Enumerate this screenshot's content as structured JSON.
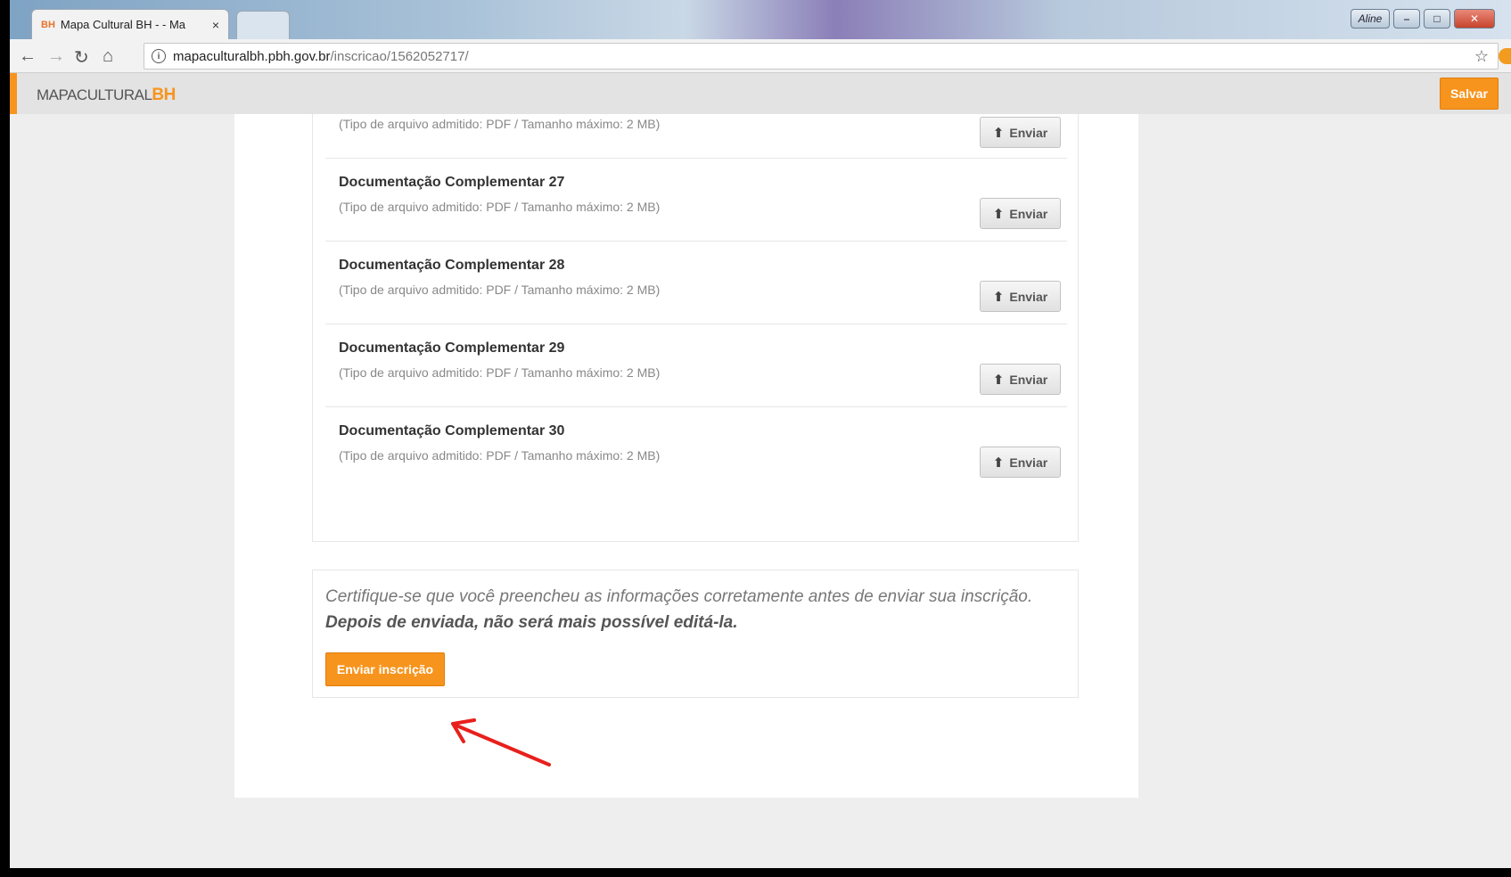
{
  "browser": {
    "tab_title": "Mapa Cultural BH - - Ma",
    "tab_favicon": "BH",
    "tab_close": "×",
    "window_user": "Aline",
    "url_host": "mapaculturalbh.pbh.gov.br",
    "url_path": "/inscricao/1562052717/"
  },
  "header": {
    "logo_text": "MAPACULTURAL",
    "logo_accent": "BH",
    "save_label": "Salvar",
    "accent_color": "#f7941d"
  },
  "partial_row": {
    "hint": "(Tipo de arquivo admitido: PDF / Tamanho máximo: 2 MB)",
    "button_label": "Enviar"
  },
  "documents": [
    {
      "title": "Documentação Complementar 27",
      "hint": "(Tipo de arquivo admitido: PDF / Tamanho máximo: 2 MB)",
      "button_label": "Enviar"
    },
    {
      "title": "Documentação Complementar 28",
      "hint": "(Tipo de arquivo admitido: PDF / Tamanho máximo: 2 MB)",
      "button_label": "Enviar"
    },
    {
      "title": "Documentação Complementar 29",
      "hint": "(Tipo de arquivo admitido: PDF / Tamanho máximo: 2 MB)",
      "button_label": "Enviar"
    },
    {
      "title": "Documentação Complementar 30",
      "hint": "(Tipo de arquivo admitido: PDF / Tamanho máximo: 2 MB)",
      "button_label": "Enviar"
    }
  ],
  "confirm": {
    "message": "Certifique-se que você preencheu as informações corretamente antes de enviar sua inscrição.",
    "warning": "Depois de enviada, não será mais possível editá-la.",
    "submit_label": "Enviar inscrição"
  },
  "icons": {
    "upload": "upload-icon",
    "annotation": "red-arrow-icon"
  }
}
